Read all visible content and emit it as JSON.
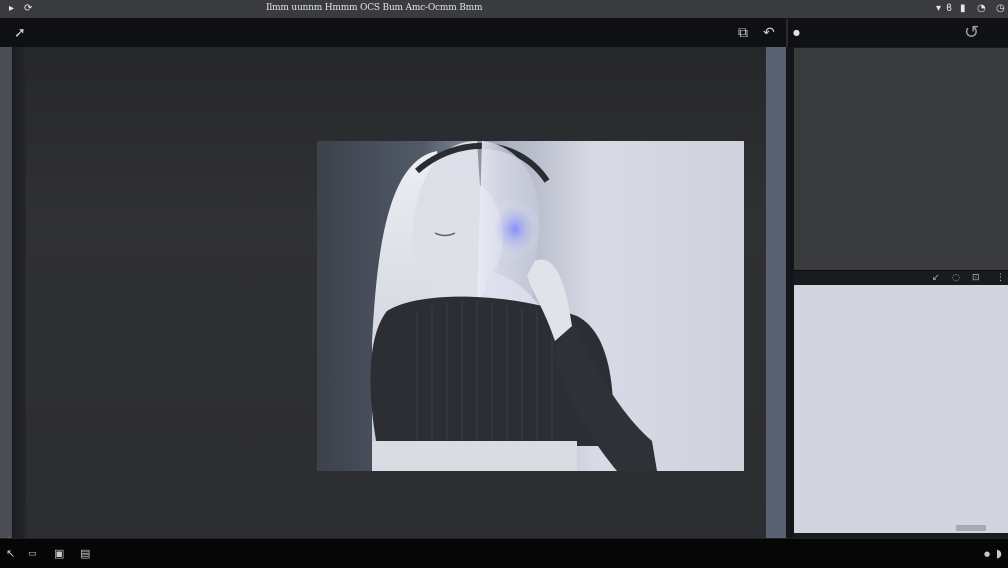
{
  "window": {
    "title": "Ilmm uunnm Hmmm OCS Bum Amc-Ocmm Bmm"
  },
  "menubar": {
    "left_icons": [
      "app-menu-icon",
      "refresh-icon"
    ],
    "right_icons": [
      "wifi-icon",
      "bluetooth-icon",
      "battery-icon",
      "user-icon",
      "clock-icon"
    ]
  },
  "toolbar": {
    "left_icons": [
      "move-tool-icon"
    ],
    "right_icons": [
      "crop-icon",
      "rotate-icon"
    ]
  },
  "panel": {
    "top_icons": [
      "menu-dot-icon",
      "rotate-left-icon"
    ],
    "divider_icons": [
      "brush-icon",
      "eye-icon",
      "layers-icon",
      "more-icon"
    ]
  },
  "statusbar": {
    "left_icons": [
      "brush-icon",
      "layer-icon",
      "image-icon",
      "screen-icon"
    ],
    "right_icons": [
      "dot-icon",
      "settings-icon"
    ]
  },
  "colors": {
    "accent": "#e0374a",
    "canvas": "#2c2d31",
    "panel_light": "#d2d4de"
  }
}
